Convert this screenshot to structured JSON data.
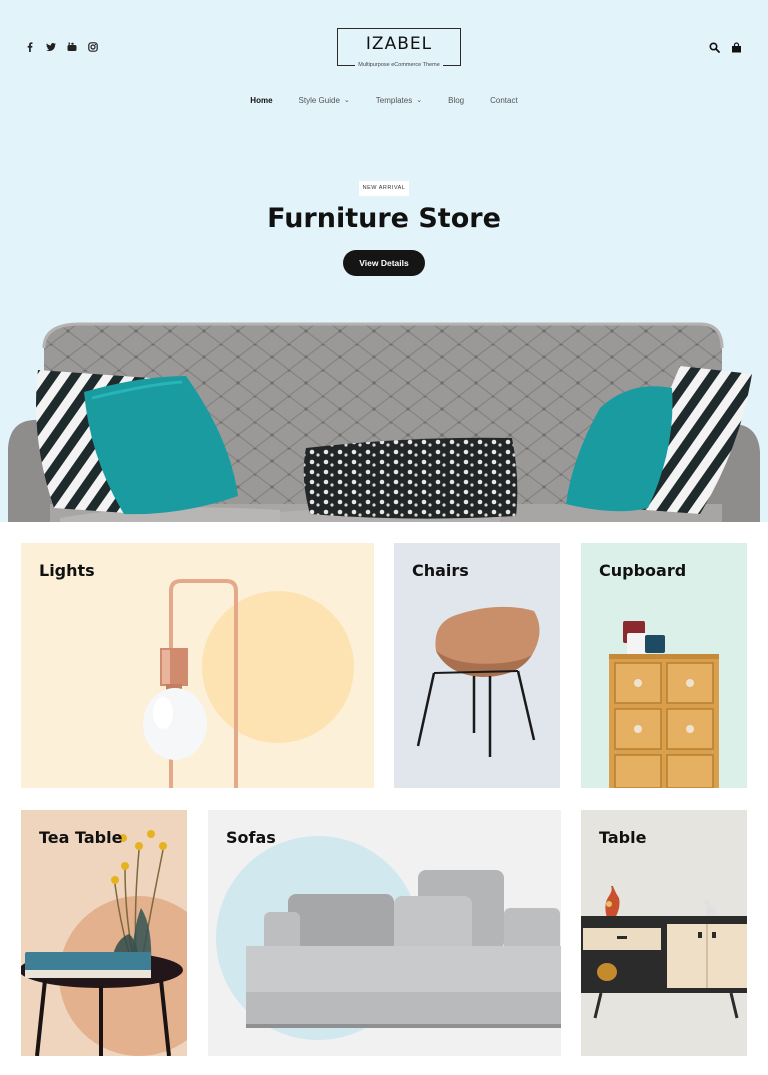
{
  "header": {
    "social_icons": [
      "facebook-icon",
      "twitter-icon",
      "youtube-icon",
      "instagram-icon"
    ],
    "logo": {
      "name": "IZABEL",
      "tagline": "Multipurpose eCommerce Theme"
    },
    "tool_icons": [
      "search-icon",
      "shopping-bag-icon"
    ]
  },
  "nav": {
    "items": [
      {
        "label": "Home",
        "active": true,
        "has_dropdown": false
      },
      {
        "label": "Style Guide",
        "active": false,
        "has_dropdown": true
      },
      {
        "label": "Templates",
        "active": false,
        "has_dropdown": true
      },
      {
        "label": "Blog",
        "active": false,
        "has_dropdown": false
      },
      {
        "label": "Contact",
        "active": false,
        "has_dropdown": false
      }
    ],
    "dropdown_glyph": "⌄"
  },
  "hero": {
    "badge": "NEW ARRIVAL",
    "title": "Furniture Store",
    "button": "View Details",
    "background": "#e2f3fa"
  },
  "categories": [
    {
      "label": "Lights",
      "bg": "#fdf0d8"
    },
    {
      "label": "Chairs",
      "bg": "#e0e6ec"
    },
    {
      "label": "Cupboard",
      "bg": "#dcf0ea"
    },
    {
      "label": "Tea Table",
      "bg": "#efd5bd"
    },
    {
      "label": "Sofas",
      "bg": "#f1f1f1"
    },
    {
      "label": "Table",
      "bg": "#e6e4df"
    }
  ],
  "colors": {
    "accent_teal": "#1a9ba0",
    "dark": "#151515"
  }
}
